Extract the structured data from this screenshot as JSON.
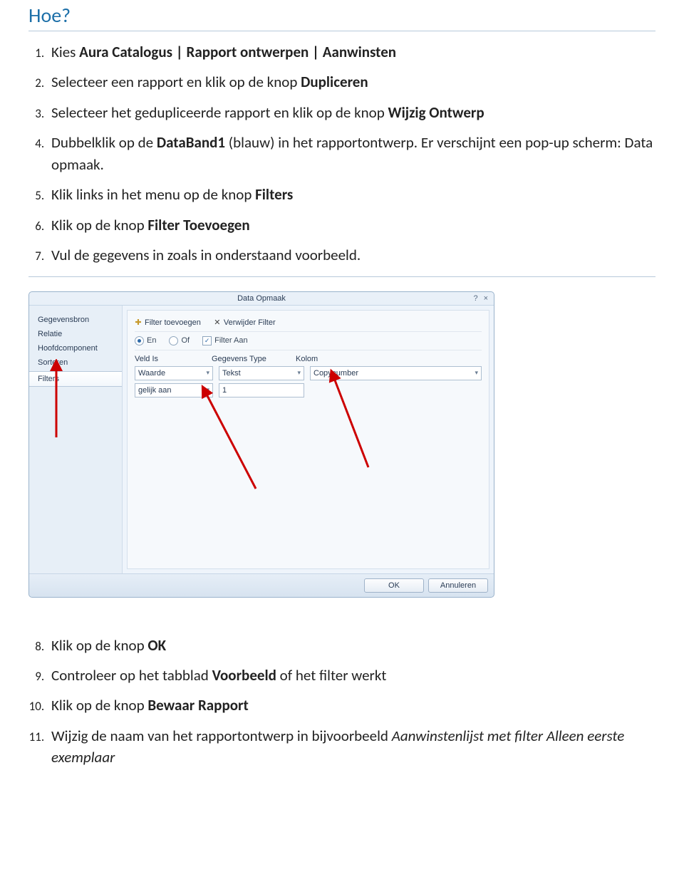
{
  "heading": "Hoe?",
  "steps": {
    "s1_a": "Kies ",
    "s1_b": "Aura Catalogus | Rapport ontwerpen | Aanwinsten",
    "s2_a": "Selecteer een rapport en klik op de knop ",
    "s2_b": "Dupliceren",
    "s3_a": "Selecteer het gedupliceerde rapport en klik op de knop ",
    "s3_b": "Wijzig Ontwerp",
    "s4_a": "Dubbelklik op de ",
    "s4_b": "DataBand1",
    "s4_c": " (blauw) in het rapportontwerp. Er verschijnt een pop-up scherm: Data opmaak.",
    "s5_a": "Klik links in het menu op de knop ",
    "s5_b": "Filters",
    "s6_a": "Klik op de knop ",
    "s6_b": "Filter Toevoegen",
    "s7": "Vul de gegevens in zoals in onderstaand voorbeeld.",
    "s8_a": "Klik op de knop ",
    "s8_b": "OK",
    "s9_a": "Controleer op het tabblad ",
    "s9_b": "Voorbeeld",
    "s9_c": " of het filter werkt",
    "s10_a": "Klik op de knop ",
    "s10_b": "Bewaar Rapport",
    "s11_a": "Wijzig de naam van het rapportontwerp in bijvoorbeeld ",
    "s11_b": "Aanwinstenlijst met filter Alleen eerste exemplaar"
  },
  "dialog": {
    "title": "Data Opmaak",
    "help": "?",
    "close": "×",
    "sidebar": {
      "i0": "Gegevensbron",
      "i1": "Relatie",
      "i2": "Hoofdcomponent",
      "i3": "Sorteren",
      "i4": "Filters"
    },
    "toolbar": {
      "add_icon": "✚",
      "add_label": "Filter toevoegen",
      "del_icon": "✕",
      "del_label": "Verwijder Filter"
    },
    "options": {
      "en": "En",
      "of": "Of",
      "filter_aan": "Filter Aan",
      "chk_mark": "✓"
    },
    "fields": {
      "h1": "Veld Is",
      "h2": "Gegevens Type",
      "h3": "Kolom",
      "v1": "Waarde",
      "v2": "Tekst",
      "v3": "Copynumber",
      "v4": "gelijk aan",
      "v5": "1"
    },
    "footer": {
      "ok": "OK",
      "cancel": "Annuleren"
    }
  }
}
